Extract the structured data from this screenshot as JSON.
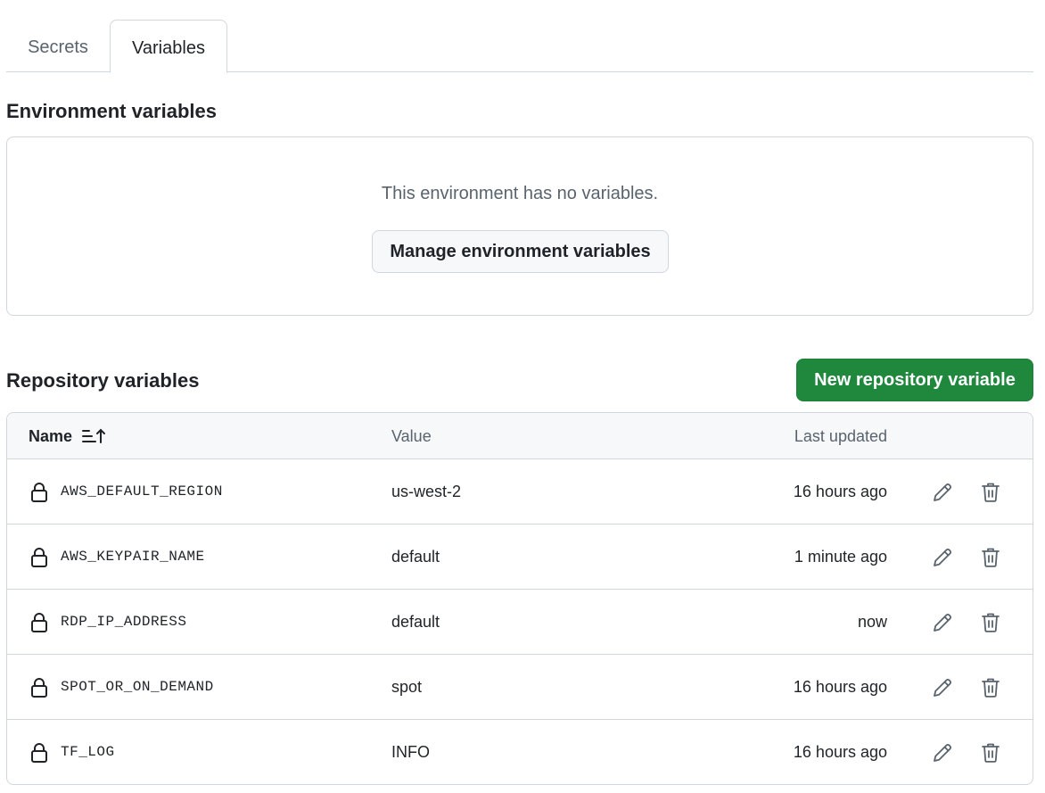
{
  "tabs": [
    {
      "label": "Secrets",
      "active": false
    },
    {
      "label": "Variables",
      "active": true
    }
  ],
  "environment": {
    "title": "Environment variables",
    "empty_text": "This environment has no variables.",
    "manage_button": "Manage environment variables"
  },
  "repository": {
    "title": "Repository variables",
    "new_button": "New repository variable",
    "columns": {
      "name": "Name",
      "value": "Value",
      "last_updated": "Last updated"
    },
    "rows": [
      {
        "name": "AWS_DEFAULT_REGION",
        "value": "us-west-2",
        "updated": "16 hours ago"
      },
      {
        "name": "AWS_KEYPAIR_NAME",
        "value": "default",
        "updated": "1 minute ago"
      },
      {
        "name": "RDP_IP_ADDRESS",
        "value": "default",
        "updated": "now"
      },
      {
        "name": "SPOT_OR_ON_DEMAND",
        "value": "spot",
        "updated": "16 hours ago"
      },
      {
        "name": "TF_LOG",
        "value": "INFO",
        "updated": "16 hours ago"
      }
    ]
  },
  "colors": {
    "primary_button": "#1f883d",
    "border": "#d0d7de",
    "muted_text": "#59636e",
    "header_bg": "#f6f8fa"
  },
  "icons": {
    "sort": "sort-ascending-icon",
    "row_lock": "lock-icon",
    "edit": "pencil-icon",
    "delete": "trash-icon"
  }
}
